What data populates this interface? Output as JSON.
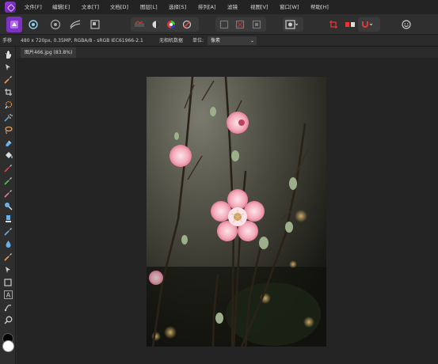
{
  "menu": [
    "文件[F]",
    "编辑[E]",
    "文本[T]",
    "文档[D]",
    "图层[L]",
    "选择[S]",
    "排列[A]",
    "滤镜",
    "视图[V]",
    "窗口[W]",
    "帮助[H]"
  ],
  "context": {
    "image_info": "480 x 720px, 0.35MP, RGBA/8 - sRGB IEC61966-2.1",
    "metadata": "无相机数据",
    "unit_label": "单位:",
    "unit_value": "像素"
  },
  "tools": [
    "hand-tool",
    "move-tool",
    "paint-brush-tool",
    "crop-tool",
    "selection-brush-tool",
    "flood-select-tool",
    "freehand-select-tool",
    "erase-brush-tool",
    "flood-fill-tool",
    "paint-brush-2-tool",
    "color-picker-tool",
    "clone-tool",
    "dodge-tool",
    "blur-tool",
    "smudge-tool",
    "healing-tool",
    "sharpen-tool",
    "node-tool",
    "rectangle-tool",
    "text-tool",
    "vector-brush-tool",
    "zoom-tool"
  ],
  "document": {
    "tab_label": "图片466.jpg (83.8%)"
  },
  "colors": {
    "accent": "#9b3fd6",
    "blossom": "#f1a7b6",
    "blossom_dark": "#d9587b",
    "background": "#242424"
  }
}
